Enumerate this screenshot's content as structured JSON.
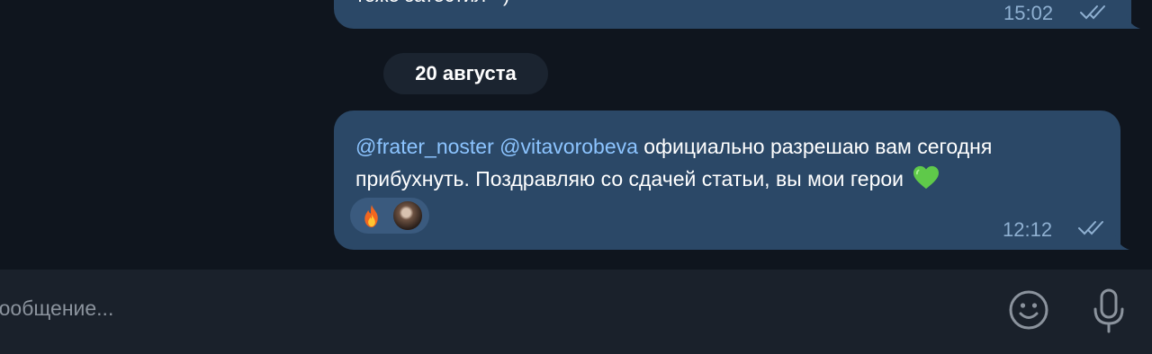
{
  "chat": {
    "previous_message": {
      "text": "тоже затестил =)",
      "time": "15:02"
    },
    "date_separator": "20 августа",
    "message": {
      "mention_1": "@frater_noster",
      "mention_2": "@vitavorobeva",
      "text_part_1": " официально разрешаю вам сегодня",
      "text_part_2": "прибухнуть. Поздравляю со сдачей статьи, вы мои герои",
      "emoji": "green-heart",
      "time": "12:12",
      "status": "read",
      "reactions": [
        {
          "emoji": "fire",
          "reactor": "avatar"
        }
      ]
    }
  },
  "composer": {
    "placeholder": "Сообщение..."
  },
  "colors": {
    "background": "#0f151e",
    "bubble": "#2b4867",
    "mention": "#8cc4ff",
    "meta": "#8fb0d1",
    "composer": "#1a212b"
  }
}
